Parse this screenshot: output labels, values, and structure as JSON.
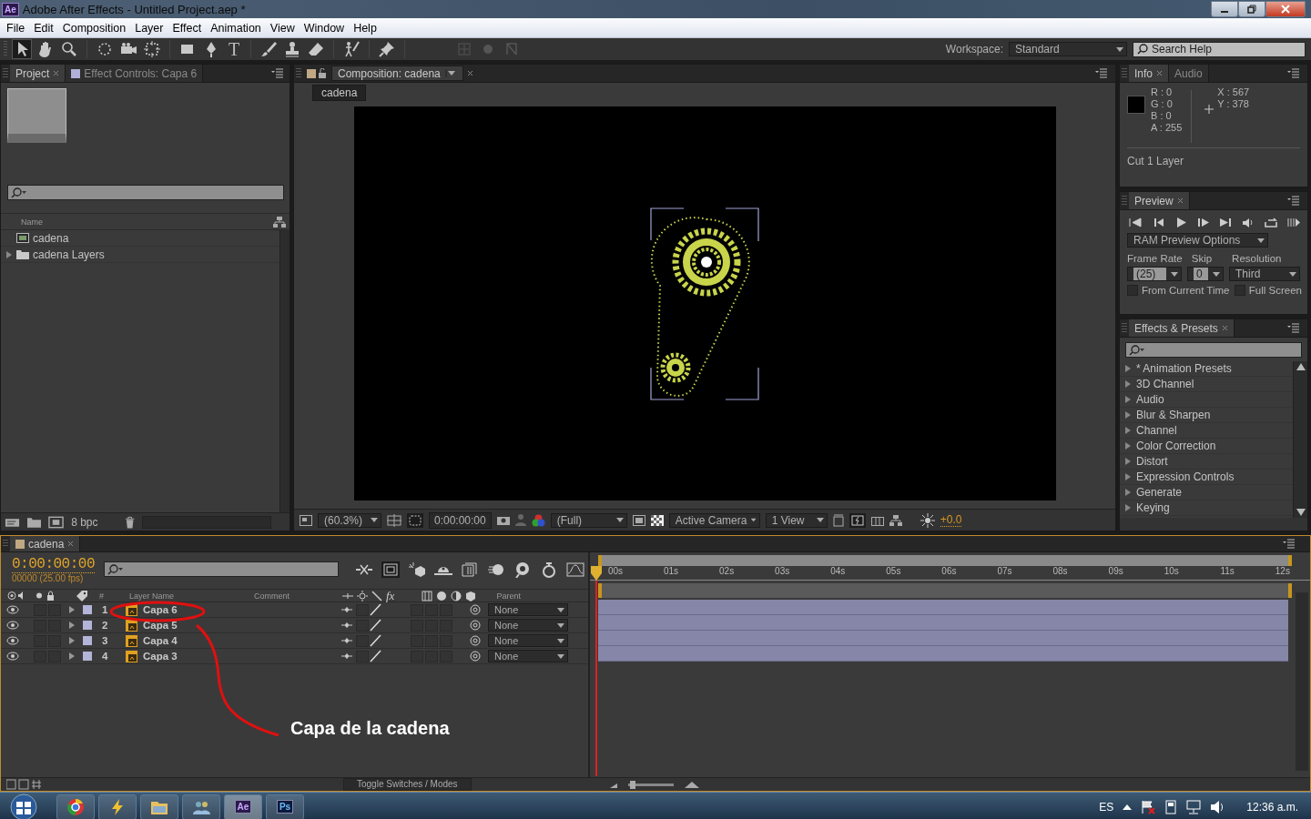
{
  "window": {
    "app_icon": "Ae",
    "title": "Adobe After Effects - Untitled Project.aep *"
  },
  "menu": [
    "File",
    "Edit",
    "Composition",
    "Layer",
    "Effect",
    "Animation",
    "View",
    "Window",
    "Help"
  ],
  "toolbar": {
    "text_tool": "T",
    "workspace_label": "Workspace:",
    "workspace": "Standard",
    "search_placeholder": "Search Help"
  },
  "project_panel": {
    "tabs": [
      {
        "label": "Project",
        "selected": true
      },
      {
        "label": "Effect Controls: Capa 6",
        "selected": false
      }
    ],
    "name_column": "Name",
    "items": [
      {
        "name": "cadena",
        "kind": "composition"
      },
      {
        "name": "cadena Layers",
        "kind": "folder"
      }
    ],
    "bit_depth": "8 bpc"
  },
  "composition_panel": {
    "tab": "Composition: cadena",
    "breadcrumb": "cadena",
    "zoom": "(60.3%)",
    "timecode": "0:00:00:00",
    "resolution": "(Full)",
    "camera": "Active Camera",
    "views": "1 View",
    "exposure": "+0.0"
  },
  "info_panel": {
    "tabs": [
      {
        "label": "Info",
        "selected": true
      },
      {
        "label": "Audio",
        "selected": false
      }
    ],
    "color_values": [
      "R : 0",
      "G : 0",
      "B : 0",
      "A : 255"
    ],
    "position": [
      "X : 567",
      "Y : 378"
    ],
    "message": "Cut 1 Layer"
  },
  "preview_panel": {
    "tab": "Preview",
    "ram_preview": "RAM Preview Options",
    "frame_rate_label": "Frame Rate",
    "skip_label": "Skip",
    "resolution_label": "Resolution",
    "frame_rate": "(25)",
    "skip": "0",
    "resolution": "Third",
    "options": [
      {
        "label": "From Current Time",
        "checked": false
      },
      {
        "label": "Full Screen",
        "checked": false
      }
    ]
  },
  "effects_panel": {
    "tab": "Effects & Presets",
    "items": [
      {
        "label": "* Animation Presets",
        "expanded": false
      },
      {
        "label": "3D Channel",
        "expanded": false
      },
      {
        "label": "Audio",
        "expanded": false
      },
      {
        "label": "Blur & Sharpen",
        "expanded": false
      },
      {
        "label": "Channel",
        "expanded": false
      },
      {
        "label": "Color Correction",
        "expanded": false
      },
      {
        "label": "Distort",
        "expanded": false
      },
      {
        "label": "Expression Controls",
        "expanded": false
      },
      {
        "label": "Generate",
        "expanded": false
      },
      {
        "label": "Keying",
        "expanded": false
      }
    ]
  },
  "timeline": {
    "tab": "cadena",
    "timecode": "0:00:00:00",
    "fps": "00000 (25.00 fps)",
    "columns": {
      "number": "#",
      "layer_name": "Layer Name",
      "comment": "Comment",
      "effects": "fx",
      "parent": "Parent"
    },
    "layers": [
      {
        "index": "1",
        "name": "Capa 6",
        "parent": "None",
        "expanded": false,
        "solo": false,
        "locked": false,
        "collapse": false,
        "effect": false,
        "motion_blur": false,
        "layer_3d": false
      },
      {
        "index": "2",
        "name": "Capa 5",
        "parent": "None",
        "expanded": false,
        "solo": false,
        "locked": false,
        "collapse": false,
        "effect": false,
        "motion_blur": false,
        "layer_3d": false
      },
      {
        "index": "3",
        "name": "Capa 4",
        "parent": "None",
        "expanded": false,
        "solo": false,
        "locked": false,
        "collapse": false,
        "effect": false,
        "motion_blur": false,
        "layer_3d": false
      },
      {
        "index": "4",
        "name": "Capa 3",
        "parent": "None",
        "expanded": false,
        "solo": false,
        "locked": false,
        "collapse": false,
        "effect": false,
        "motion_blur": false,
        "layer_3d": false
      }
    ],
    "ruler": [
      "00s",
      "01s",
      "02s",
      "03s",
      "04s",
      "05s",
      "06s",
      "07s",
      "08s",
      "09s",
      "10s",
      "11s",
      "12s"
    ],
    "toggle": "Toggle Switches / Modes",
    "zoom": {
      "level": 0.05
    }
  },
  "annotation": {
    "text": "Capa de la cadena"
  },
  "taskbar": {
    "apps": [
      {
        "kind": "browser",
        "active": false
      },
      {
        "kind": "bolt",
        "active": false
      },
      {
        "kind": "folder",
        "active": false
      },
      {
        "kind": "people",
        "active": false
      },
      {
        "kind": "text",
        "label": "Ae",
        "active": true
      },
      {
        "kind": "text",
        "label": "Ps",
        "active": false
      }
    ],
    "language": "ES",
    "clock": "12:36 a.m."
  }
}
